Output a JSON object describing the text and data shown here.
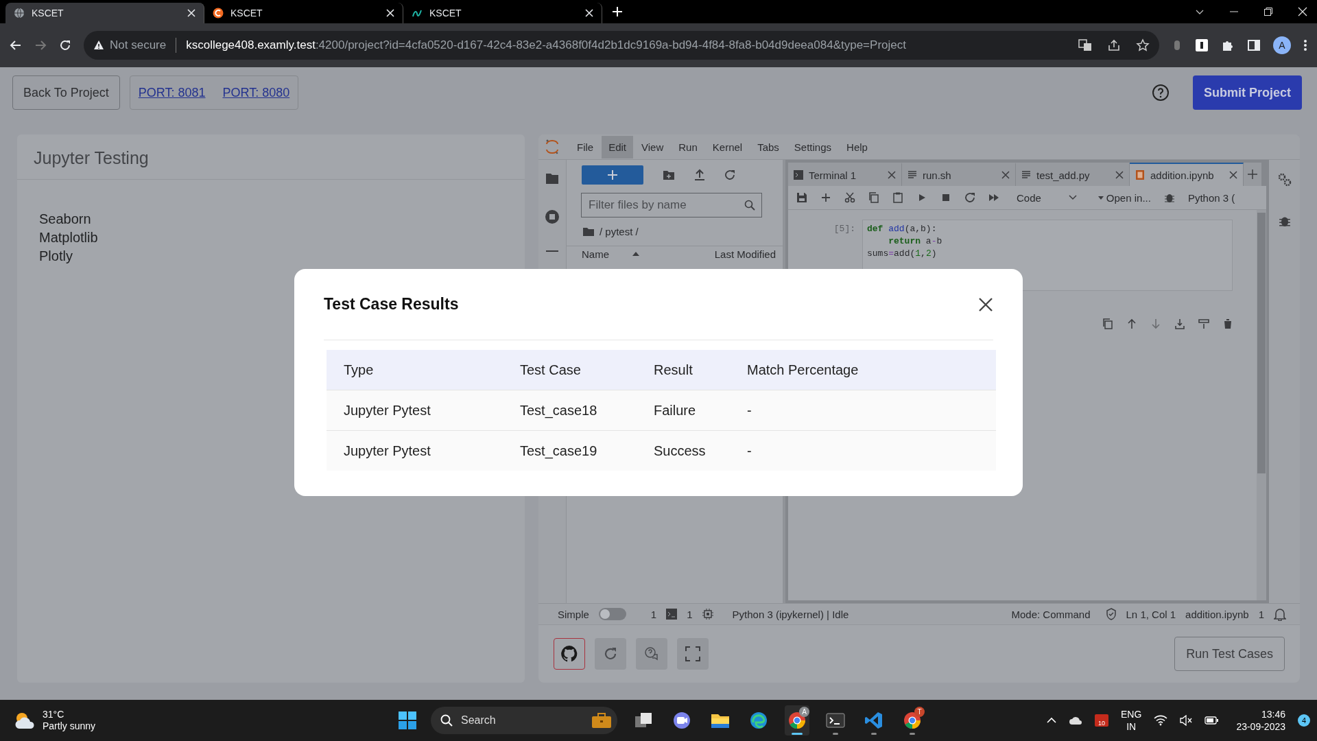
{
  "browser": {
    "tabs": [
      {
        "title": "KSCET",
        "kind": "globe",
        "selected": true
      },
      {
        "title": "KSCET",
        "kind": "orange",
        "selected": false
      },
      {
        "title": "KSCET",
        "kind": "teal",
        "selected": false
      }
    ],
    "security": "Not secure",
    "url_host": "kscollege408.examly.test",
    "url_path": ":4200/project?id=4cfa0520-d167-42c4-83e2-a4368f0f4d2b1dc9169a-bd94-4f84-8fa8-b04d9deea084&type=Project",
    "profile": "A"
  },
  "header": {
    "back_button": "Back To Project",
    "ports": [
      "PORT: 8081",
      "PORT: 8080"
    ],
    "submit_button": "Submit Project"
  },
  "project": {
    "title": "Jupyter Testing",
    "libraries": [
      "Seaborn",
      "Matplotlib",
      "Plotly"
    ]
  },
  "jupyter": {
    "menu": [
      {
        "label": "File",
        "selected": false
      },
      {
        "label": "Edit",
        "selected": true
      },
      {
        "label": "View",
        "selected": false
      },
      {
        "label": "Run",
        "selected": false
      },
      {
        "label": "Kernel",
        "selected": false
      },
      {
        "label": "Tabs",
        "selected": false
      },
      {
        "label": "Settings",
        "selected": false
      },
      {
        "label": "Help",
        "selected": false
      }
    ],
    "file_browser": {
      "filter": {
        "placeholder": "Filter files by name"
      },
      "path": "/ pytest /",
      "columns": [
        "Name",
        "Last Modified"
      ]
    },
    "tabs": [
      {
        "label": "Terminal 1",
        "kind": "terminal",
        "selected": false
      },
      {
        "label": "run.sh",
        "kind": "text",
        "selected": false
      },
      {
        "label": "test_add.py",
        "kind": "text",
        "selected": false
      },
      {
        "label": "addition.ipynb",
        "kind": "notebook",
        "selected": true
      }
    ],
    "toolbar": {
      "cell_type": "Code",
      "open_in": "Open in...",
      "kernel": "Python 3 ("
    },
    "cell": {
      "prompt": "[5]:",
      "lines": [
        [
          {
            "text": "def",
            "kind": "keyword"
          },
          {
            "text": " add",
            "kind": "function"
          },
          {
            "text": "(a,b):",
            "kind": "plain"
          }
        ],
        [
          {
            "text": "    return",
            "kind": "keyword"
          },
          {
            "text": " a",
            "kind": "plain"
          },
          {
            "text": "-",
            "kind": "operator"
          },
          {
            "text": "b",
            "kind": "plain"
          }
        ],
        [
          {
            "text": "sums",
            "kind": "plain"
          },
          {
            "text": "=",
            "kind": "operator"
          },
          {
            "text": "add(",
            "kind": "plain"
          },
          {
            "text": "1",
            "kind": "number"
          },
          {
            "text": ",",
            "kind": "plain"
          },
          {
            "text": "2",
            "kind": "number"
          },
          {
            "text": ")",
            "kind": "plain"
          }
        ]
      ]
    },
    "status": {
      "simple": {
        "label": "Simple",
        "on": false
      },
      "terminals": "1",
      "kernels": "1",
      "kernel_status": "Python 3 (ipykernel) | Idle",
      "mode": "Mode: Command",
      "position": "Ln 1, Col 1",
      "file": "addition.ipynb",
      "notifications": "1"
    },
    "run_button": "Run Test Cases"
  },
  "modal": {
    "title": "Test Case Results",
    "columns": [
      "Type",
      "Test Case",
      "Result",
      "Match Percentage"
    ],
    "rows": [
      [
        "Jupyter Pytest",
        "Test_case18",
        "Failure",
        "-"
      ],
      [
        "Jupyter Pytest",
        "Test_case19",
        "Success",
        "-"
      ]
    ]
  },
  "taskbar": {
    "weather": {
      "temp": "31°C",
      "condition": "Partly sunny"
    },
    "search": {
      "placeholder": "Search"
    },
    "apps": [
      {
        "kind": "stack",
        "running": false,
        "selected": false
      },
      {
        "kind": "chat",
        "running": false,
        "selected": false
      },
      {
        "kind": "folder",
        "running": false,
        "selected": false
      },
      {
        "kind": "edge",
        "running": false,
        "selected": false
      },
      {
        "kind": "chrome",
        "badge": "A",
        "running": true,
        "selected": true
      },
      {
        "kind": "terminal",
        "running": true,
        "selected": false
      },
      {
        "kind": "vscode",
        "running": true,
        "selected": false
      },
      {
        "kind": "chrome",
        "badge": "T",
        "running": true,
        "selected": false
      }
    ],
    "tray": {
      "calendar_badge": "10",
      "language": "ENG",
      "region": "IN"
    },
    "clock": {
      "time": "13:46",
      "date": "23-09-2023"
    },
    "notifications": "4"
  }
}
